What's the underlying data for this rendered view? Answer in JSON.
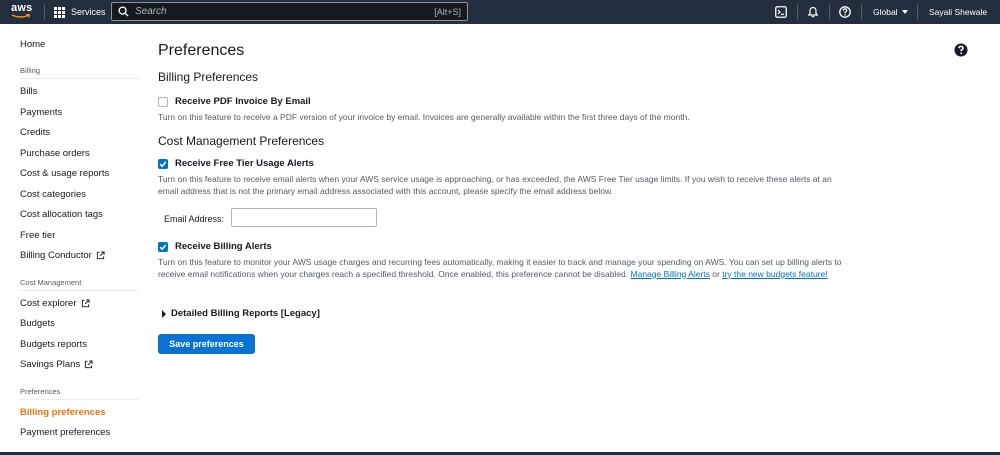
{
  "topnav": {
    "logo_text": "aws",
    "services_label": "Services",
    "search_placeholder": "Search",
    "search_shortcut": "[Alt+S]",
    "region_label": "Global",
    "user_label": "Sayali Shewale",
    "icons": [
      "cloudshell-icon",
      "bell-icon",
      "help-circle-icon"
    ],
    "bg_color": "#232f3e"
  },
  "sidebar": {
    "home": "Home",
    "sections": {
      "billing": "Billing",
      "cost_management": "Cost Management",
      "preferences": "Preferences"
    },
    "billing_items": [
      {
        "label": "Bills"
      },
      {
        "label": "Payments"
      },
      {
        "label": "Credits"
      },
      {
        "label": "Purchase orders"
      },
      {
        "label": "Cost & usage reports"
      },
      {
        "label": "Cost categories"
      },
      {
        "label": "Cost allocation tags"
      },
      {
        "label": "Free tier"
      },
      {
        "label": "Billing Conductor",
        "external": true
      }
    ],
    "cost_items": [
      {
        "label": "Cost explorer",
        "external": true
      },
      {
        "label": "Budgets"
      },
      {
        "label": "Budgets reports"
      },
      {
        "label": "Savings Plans",
        "external": true
      }
    ],
    "preference_items": [
      {
        "label": "Billing preferences",
        "active": true
      },
      {
        "label": "Payment preferences"
      }
    ],
    "active_color": "#ec7211"
  },
  "main": {
    "title": "Preferences",
    "billing_prefs_title": "Billing Preferences",
    "pdf_invoice": {
      "label": "Receive PDF Invoice By Email",
      "checked": false,
      "description": "Turn on this feature to receive a PDF version of your invoice by email. Invoices are generally available within the first three days of the month."
    },
    "cost_mgmt_title": "Cost Management Preferences",
    "free_tier": {
      "label": "Receive Free Tier Usage Alerts",
      "checked": true,
      "description": "Turn on this feature to receive email alerts when your AWS service usage is approaching, or has exceeded, the AWS Free Tier usage limits. If you wish to receive these alerts at an email address that is not the primary email address associated with this account, please specify the email address below."
    },
    "email_label": "Email Address:",
    "email_value": "",
    "billing_alerts": {
      "label": "Receive Billing Alerts",
      "checked": true,
      "description": "Turn on this feature to monitor your AWS usage charges and recurring fees automatically, making it easier to track and manage your spending on AWS. You can set up billing alerts to receive email notifications when your charges reach a specified threshold. Once enabled, this preference cannot be disabled.",
      "link1": "Manage Billing Alerts",
      "connector": "or",
      "link2": "try the new budgets feature!"
    },
    "detailed_reports_label": "Detailed Billing Reports [Legacy]",
    "save_button": "Save preferences",
    "accent_color": "#0073bb"
  }
}
